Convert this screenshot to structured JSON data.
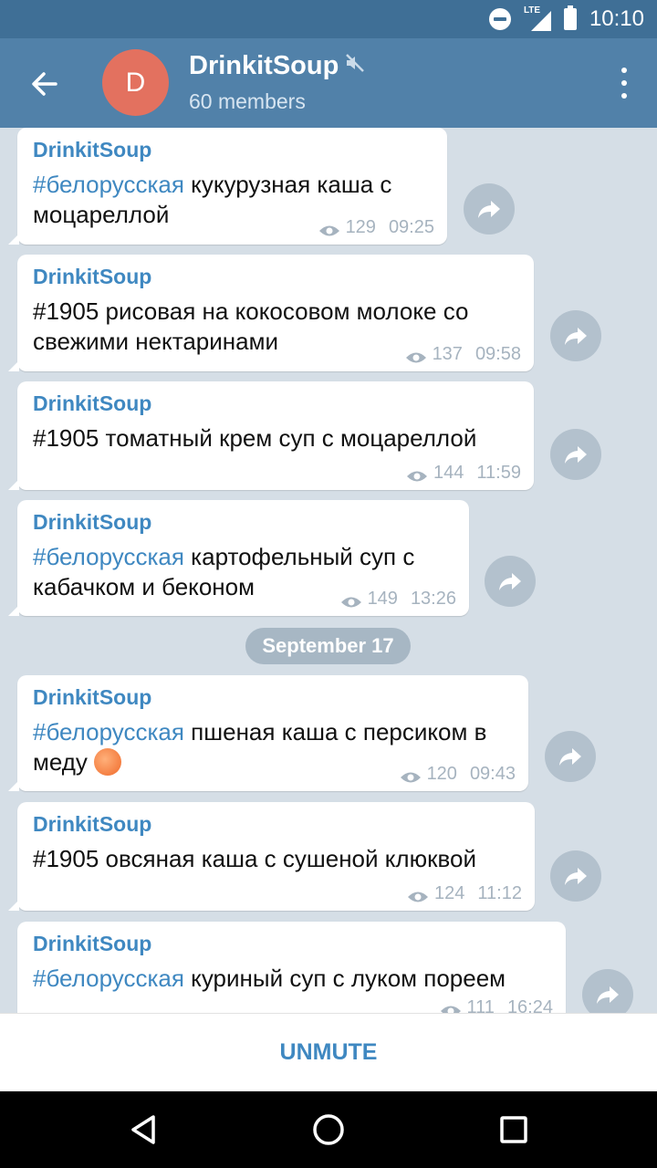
{
  "status_bar": {
    "time": "10:10",
    "network": "LTE",
    "icons": [
      "do-not-disturb-icon",
      "signal-icon",
      "battery-icon"
    ]
  },
  "header": {
    "avatar_letter": "D",
    "title": "DrinkitSoup",
    "subtitle": "60 members",
    "avatar_color": "#e3715f",
    "header_color": "#5181a9"
  },
  "messages": [
    {
      "author": "DrinkitSoup",
      "hashtag": "#белорусская",
      "text": " кукурузная каша с моцареллой",
      "views": "129",
      "time": "09:25"
    },
    {
      "author": "DrinkitSoup",
      "hashtag": "",
      "text": "#1905 рисовая на кокосовом молоке со свежими нектаринами",
      "views": "137",
      "time": "09:58"
    },
    {
      "author": "DrinkitSoup",
      "hashtag": "",
      "text": "#1905 томатный крем суп с моцареллой",
      "views": "144",
      "time": "11:59"
    },
    {
      "author": "DrinkitSoup",
      "hashtag": "#белорусская",
      "text": " картофельный суп с кабачком и беконом",
      "views": "149",
      "time": "13:26"
    },
    {
      "author": "DrinkitSoup",
      "hashtag": "#белорусская",
      "text": " пшеная каша с персиком в меду",
      "views": "120",
      "time": "09:43"
    },
    {
      "author": "DrinkitSoup",
      "hashtag": "",
      "text": "#1905 овсяная каша с сушеной клюквой",
      "views": "124",
      "time": "11:12"
    },
    {
      "author": "DrinkitSoup",
      "hashtag": "#белорусская",
      "text": " куриный суп с луком пореем",
      "views": "111",
      "time": "16:24"
    }
  ],
  "date_separator": "September 17",
  "bottom": {
    "unmute_label": "UNMUTE"
  },
  "colors": {
    "accent": "#3f88c1",
    "bubble": "#ffffff",
    "chat_bg": "#d5dee6"
  }
}
